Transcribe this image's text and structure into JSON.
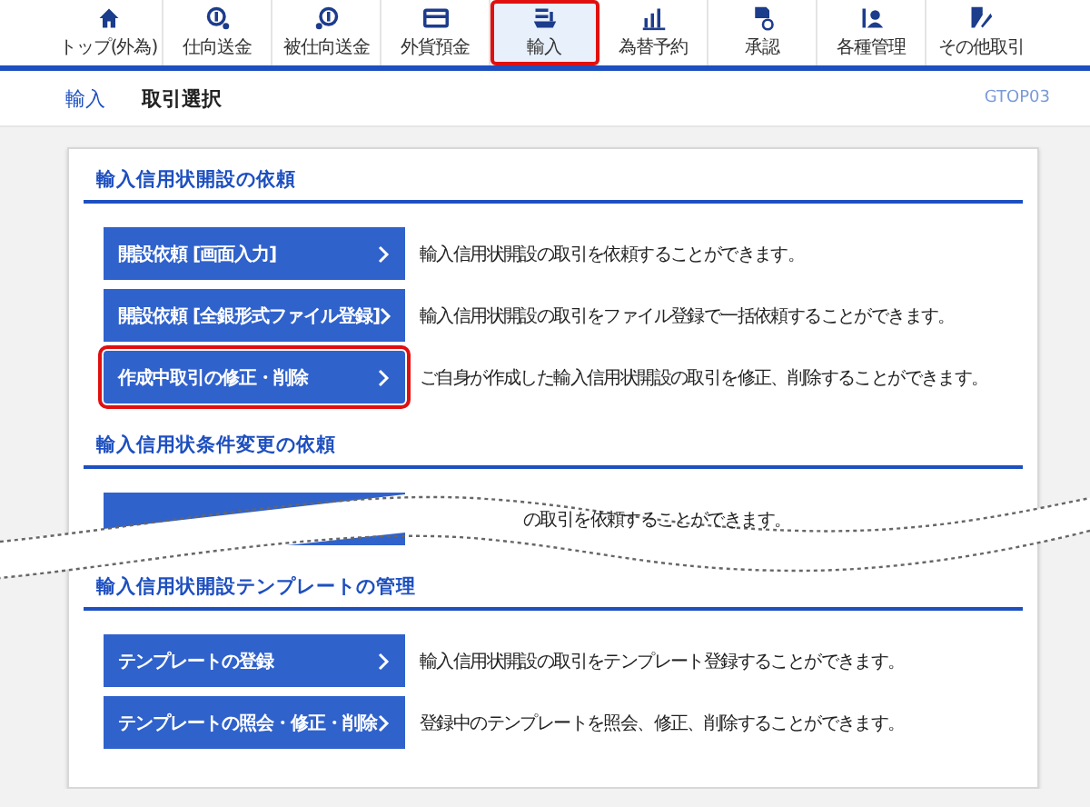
{
  "nav": [
    {
      "label": "トップ(外為)",
      "selected": false,
      "highlighted": false
    },
    {
      "label": "仕向送金",
      "selected": false,
      "highlighted": false
    },
    {
      "label": "被仕向送金",
      "selected": false,
      "highlighted": false
    },
    {
      "label": "外貨預金",
      "selected": false,
      "highlighted": false
    },
    {
      "label": "輸入",
      "selected": true,
      "highlighted": true
    },
    {
      "label": "為替予約",
      "selected": false,
      "highlighted": false
    },
    {
      "label": "承認",
      "selected": false,
      "highlighted": false
    },
    {
      "label": "各種管理",
      "selected": false,
      "highlighted": false
    },
    {
      "label": "その他取引",
      "selected": false,
      "highlighted": false
    }
  ],
  "header": {
    "category": "輸入",
    "title": "取引選択",
    "screen_id": "GTOP03"
  },
  "sections": [
    {
      "title": "輸入信用状開設の依頼",
      "items": [
        {
          "label": "開設依頼 [画面入力]",
          "description": "輸入信用状開設の取引を依頼することができます。",
          "highlighted": false
        },
        {
          "label": "開設依頼 [全銀形式ファイル登録]",
          "description": "輸入信用状開設の取引をファイル登録で一括依頼することができます。",
          "highlighted": false
        },
        {
          "label": "作成中取引の修正・削除",
          "description": "ご自身が作成した輸入信用状開設の取引を修正、削除することができます。",
          "highlighted": true
        }
      ]
    },
    {
      "title": "輸入信用状条件変更の依頼",
      "cut": true,
      "items": [
        {
          "description": "の取引を依頼することができます。",
          "highlighted": false
        }
      ]
    },
    {
      "title": "輸入信用状開設テンプレートの管理",
      "items": [
        {
          "label": "テンプレートの登録",
          "description": "輸入信用状開設の取引をテンプレート登録することができます。",
          "highlighted": false
        },
        {
          "label": "テンプレートの照会・修正・削除",
          "description": "登録中のテンプレートを照会、修正、削除することができます。",
          "highlighted": false
        }
      ]
    }
  ]
}
